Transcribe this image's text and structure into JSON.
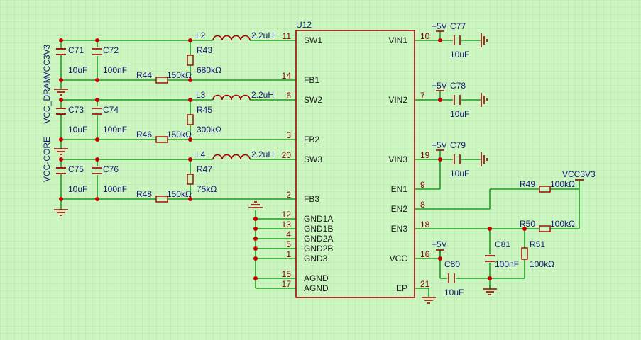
{
  "chip": {
    "ref": "U12",
    "left_pins": [
      {
        "num": "11",
        "name": "SW1"
      },
      {
        "num": "14",
        "name": "FB1"
      },
      {
        "num": "6",
        "name": "SW2"
      },
      {
        "num": "3",
        "name": "FB2"
      },
      {
        "num": "20",
        "name": "SW3"
      },
      {
        "num": "2",
        "name": "FB3"
      },
      {
        "num": "12",
        "name": "GND1A"
      },
      {
        "num": "13",
        "name": "GND1B"
      },
      {
        "num": "4",
        "name": "GND2A"
      },
      {
        "num": "5",
        "name": "GND2B"
      },
      {
        "num": "1",
        "name": "GND3"
      },
      {
        "num": "15",
        "name": "AGND"
      },
      {
        "num": "17",
        "name": "AGND"
      }
    ],
    "right_pins": [
      {
        "num": "10",
        "name": "VIN1"
      },
      {
        "num": "7",
        "name": "VIN2"
      },
      {
        "num": "19",
        "name": "VIN3"
      },
      {
        "num": "9",
        "name": "EN1"
      },
      {
        "num": "8",
        "name": "EN2"
      },
      {
        "num": "18",
        "name": "EN3"
      },
      {
        "num": "16",
        "name": "VCC"
      },
      {
        "num": "21",
        "name": "EP"
      }
    ]
  },
  "rails": {
    "vcc3v3": "VCC3V3",
    "vcc_dram": "VCC_DRAM",
    "vcc_core": "VCC-CORE",
    "p5v": "+5V",
    "vcc3v3_right": "VCC3V3"
  },
  "channels": [
    {
      "c_out_a": "C71",
      "c_out_a_val": "10uF",
      "c_out_b": "C72",
      "c_out_b_val": "100nF",
      "inductor": "L2",
      "inductor_val": "2.2uH",
      "r_top": "R43",
      "r_top_val": "680kΩ",
      "r_bot": "R44",
      "r_bot_val": "150kΩ"
    },
    {
      "c_out_a": "C73",
      "c_out_a_val": "10uF",
      "c_out_b": "C74",
      "c_out_b_val": "100nF",
      "inductor": "L3",
      "inductor_val": "2.2uH",
      "r_top": "R45",
      "r_top_val": "300kΩ",
      "r_bot": "R46",
      "r_bot_val": "150kΩ"
    },
    {
      "c_out_a": "C75",
      "c_out_a_val": "10uF",
      "c_out_b": "C76",
      "c_out_b_val": "100nF",
      "inductor": "L4",
      "inductor_val": "2.2uH",
      "r_top": "R47",
      "r_top_val": "75kΩ",
      "r_bot": "R48",
      "r_bot_val": "150kΩ"
    }
  ],
  "input_caps": [
    {
      "ref": "C77",
      "val": "10uF"
    },
    {
      "ref": "C78",
      "val": "10uF"
    },
    {
      "ref": "C79",
      "val": "10uF"
    }
  ],
  "enable": {
    "r49": "R49",
    "r49_val": "100kΩ",
    "r50": "R50",
    "r50_val": "100kΩ",
    "c81": "C81",
    "c81_val": "100nF",
    "r51": "R51",
    "r51_val": "100kΩ"
  },
  "vcc_cap": {
    "ref": "C80",
    "val": "10uF"
  },
  "colors": {
    "background": "#ccf5c2",
    "grid": "#a8e89a",
    "wire": "#1f9e1f",
    "component": "#a30000",
    "junction": "#c80000",
    "label": "#1a1a7a"
  }
}
